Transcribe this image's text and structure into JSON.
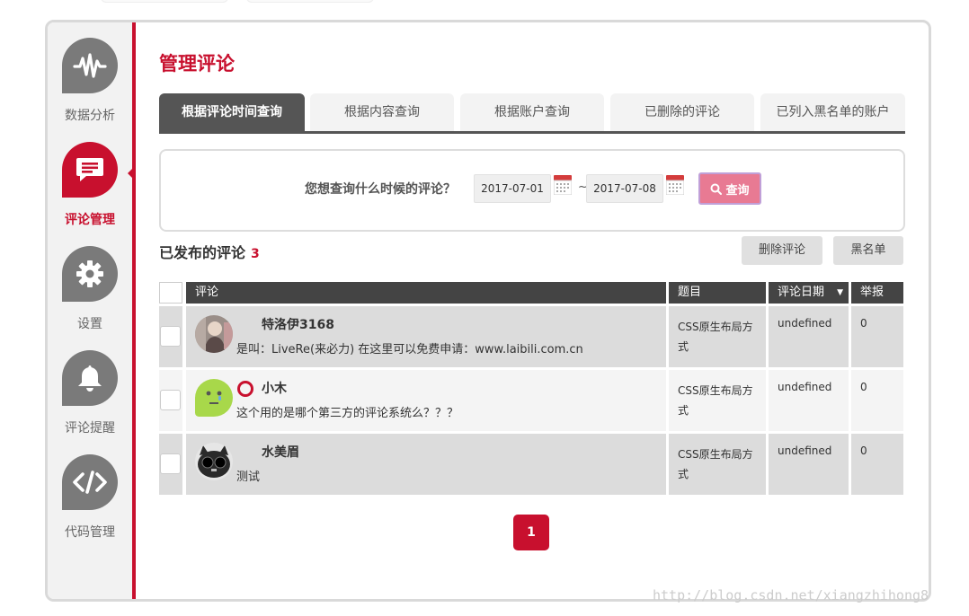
{
  "sidebar": {
    "items": [
      {
        "label": "数据分析",
        "icon": "waveform-icon"
      },
      {
        "label": "评论管理",
        "icon": "comment-icon"
      },
      {
        "label": "设置",
        "icon": "gear-icon"
      },
      {
        "label": "评论提醒",
        "icon": "bell-icon"
      },
      {
        "label": "代码管理",
        "icon": "code-icon"
      }
    ],
    "active": "评论管理"
  },
  "page": {
    "title": "管理评论"
  },
  "tabs": [
    {
      "label": "根据评论时间查询",
      "active": true
    },
    {
      "label": "根据内容查询",
      "active": false
    },
    {
      "label": "根据账户查询",
      "active": false
    },
    {
      "label": "已删除的评论",
      "active": false
    },
    {
      "label": "已列入黑名单的账户",
      "active": false
    }
  ],
  "query": {
    "label": "您想查询什么时候的评论？",
    "start_date": "2017-07-01",
    "separator": "~",
    "end_date": "2017-07-08",
    "search_label": "查询"
  },
  "published": {
    "title": "已发布的评论",
    "count": "3",
    "delete_label": "删除评论",
    "blacklist_label": "黑名单"
  },
  "table": {
    "headers": {
      "comment": "评论",
      "subject": "题目",
      "date": "评论日期",
      "report": "举报"
    },
    "rows": [
      {
        "user": "特洛伊3168",
        "text": "是叫：LiveRe(来必力) 在这里可以免费申请：www.laibili.com.cn",
        "subject": "CSS原生布局方式",
        "date": "undefined",
        "report": "0",
        "shade": "#dcdcdc"
      },
      {
        "user": "小木",
        "text": "这个用的是哪个第三方的评论系统么？？？",
        "subject": "CSS原生布局方式",
        "date": "undefined",
        "report": "0",
        "shade": "#f4f4f4"
      },
      {
        "user": "水美眉",
        "text": "测试",
        "subject": "CSS原生布局方式",
        "date": "undefined",
        "report": "0",
        "shade": "#dcdcdc"
      }
    ]
  },
  "pagination": {
    "current": "1"
  },
  "watermark": "http://blog.csdn.net/xiangzhihong8",
  "colors": {
    "accent": "#c8102e",
    "tab_active": "#555555",
    "search_button": "#e87a93"
  }
}
